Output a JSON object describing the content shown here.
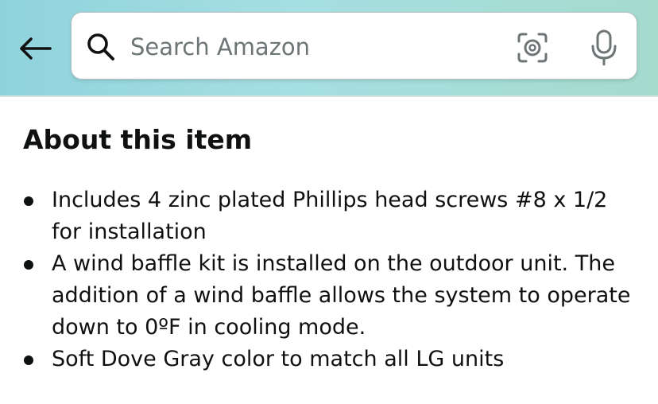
{
  "search": {
    "placeholder": "Search Amazon"
  },
  "icons": {
    "back": "arrow-left-icon",
    "search": "search-icon",
    "camera": "camera-lens-icon",
    "mic": "microphone-icon"
  },
  "about": {
    "title": "About this item",
    "bullets": [
      "Includes 4 zinc plated Phillips head screws #8 x 1/2 for installation",
      "A wind baffle kit is installed on the outdoor unit. The addition of a wind baffle allows the system to operate down to 0ºF in cooling mode.",
      "Soft Dove Gray color to match all LG units"
    ]
  },
  "colors": {
    "header_gradient_start": "#8fd3dc",
    "header_gradient_end": "#a4dbcd",
    "text": "#0f1111",
    "placeholder": "#6d7576"
  }
}
